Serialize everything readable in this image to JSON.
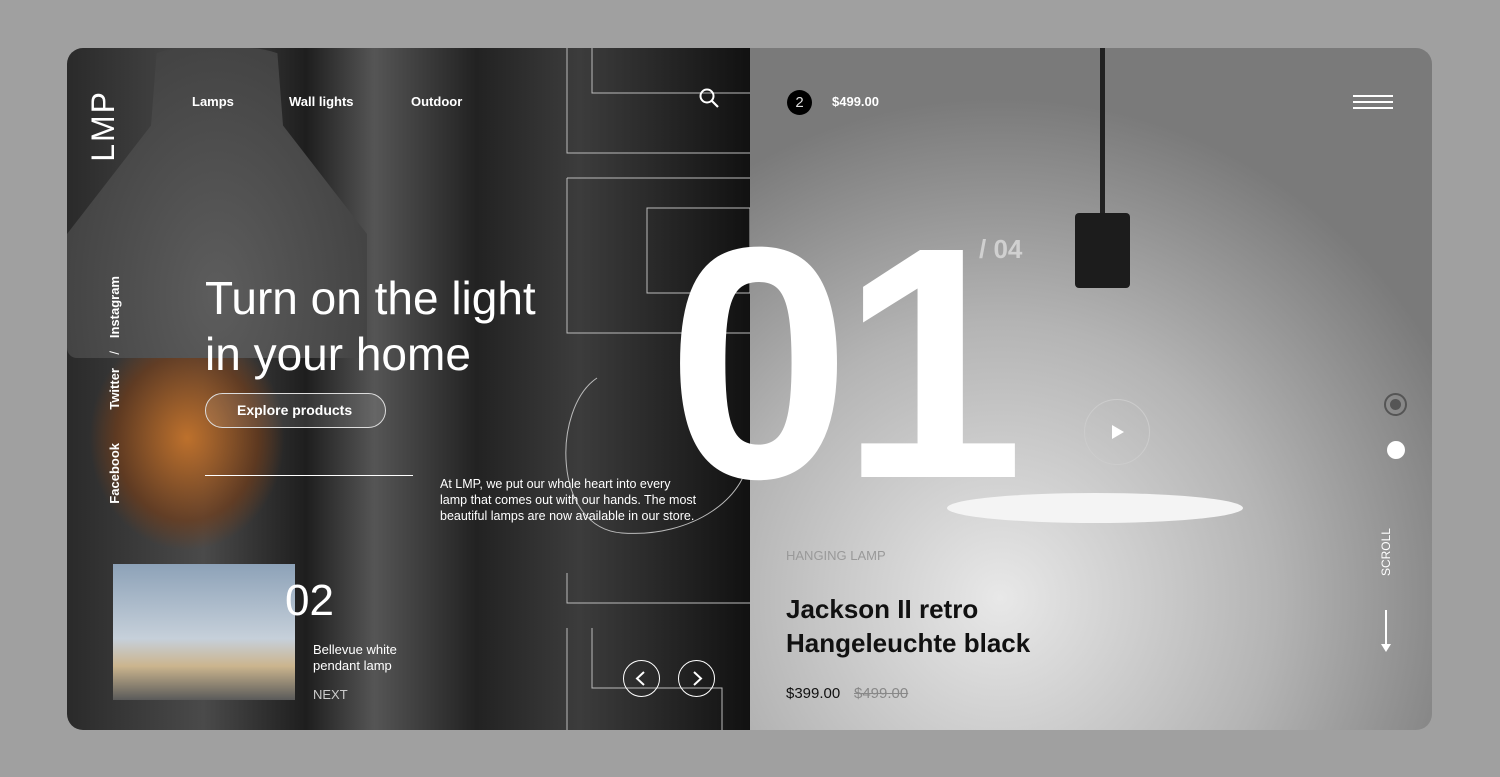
{
  "logo": "LMP",
  "nav": [
    "Lamps",
    "Wall lights",
    "Outdoor"
  ],
  "social": [
    "Instagram",
    "Twitter",
    "Facebook"
  ],
  "social_separator": "/",
  "hero": {
    "line1": "Turn on the light",
    "line2": "in your home",
    "cta": "Explore products",
    "description": "At LMP, we put our whole heart into every lamp that comes out with our hands. The most beautiful lamps are now available in our store."
  },
  "next": {
    "number": "02",
    "name": "Bellevue white pendant lamp",
    "label": "NEXT"
  },
  "slide": {
    "current": "01",
    "total": "/ 04"
  },
  "cart": {
    "count": "2",
    "total": "$499.00"
  },
  "product": {
    "category": "HANGING LAMP",
    "name_line1": "Jackson II retro",
    "name_line2": "Hangeleuchte black",
    "price": "$399.00",
    "old_price": "$499.00"
  },
  "scroll_label": "SCROLL",
  "icons": [
    "search-icon",
    "menu-icon",
    "play-icon",
    "chevron-left-icon",
    "chevron-right-icon",
    "arrow-down-icon"
  ]
}
